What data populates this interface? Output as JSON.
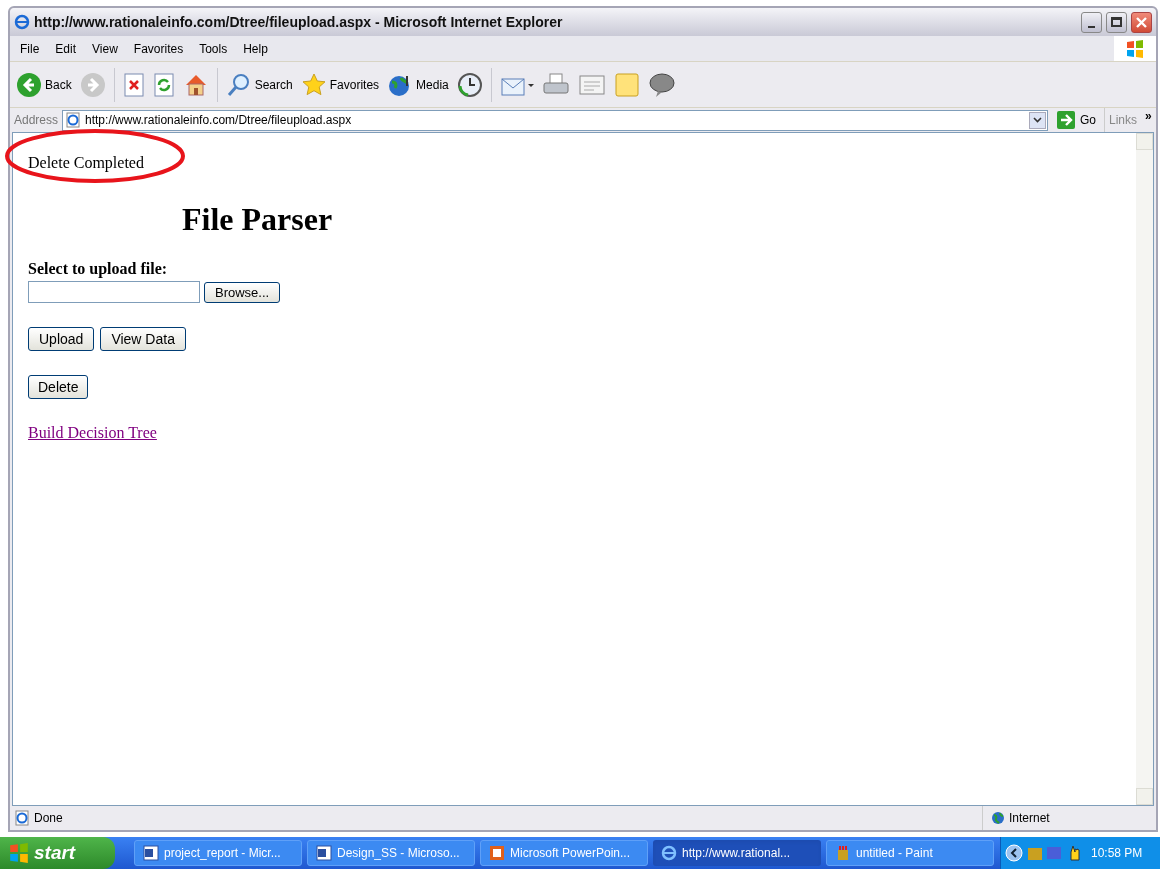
{
  "window": {
    "title": "http://www.rationaleinfo.com/Dtree/fileupload.aspx - Microsoft Internet Explorer"
  },
  "menu": [
    "File",
    "Edit",
    "View",
    "Favorites",
    "Tools",
    "Help"
  ],
  "toolbar": [
    {
      "kind": "back",
      "label": "Back"
    },
    {
      "kind": "forward"
    },
    {
      "kind": "stop"
    },
    {
      "kind": "refresh"
    },
    {
      "kind": "home"
    },
    {
      "kind": "search",
      "label": "Search"
    },
    {
      "kind": "favorites",
      "label": "Favorites"
    },
    {
      "kind": "media",
      "label": "Media"
    },
    {
      "kind": "history"
    },
    {
      "kind": "mail"
    },
    {
      "kind": "print"
    },
    {
      "kind": "edit"
    },
    {
      "kind": "note"
    },
    {
      "kind": "messenger"
    }
  ],
  "address_bar": {
    "label": "Address",
    "value": "http://www.rationaleinfo.com/Dtree/fileupload.aspx",
    "go": "Go",
    "links": "Links",
    "more": "»"
  },
  "page": {
    "message": "Delete Completed",
    "heading": "File Parser",
    "upload_label": "Select to upload file:",
    "browse": "Browse...",
    "buttons": [
      "Upload",
      "View Data"
    ],
    "delete": "Delete",
    "link": "Build Decision Tree"
  },
  "status_bar": {
    "text": "Done",
    "zone": "Internet"
  },
  "taskbar": {
    "start": "start",
    "items": [
      {
        "kind": "word",
        "label": "project_report - Micr...",
        "selected": false
      },
      {
        "kind": "word",
        "label": "Design_SS - Microso...",
        "selected": false
      },
      {
        "kind": "powerpoint",
        "label": "Microsoft PowerPoin...",
        "selected": false
      },
      {
        "kind": "ie",
        "label": "http://www.rational...",
        "selected": true
      },
      {
        "kind": "paint",
        "label": "untitled - Paint",
        "selected": false
      }
    ],
    "clock": "10:58 PM"
  }
}
